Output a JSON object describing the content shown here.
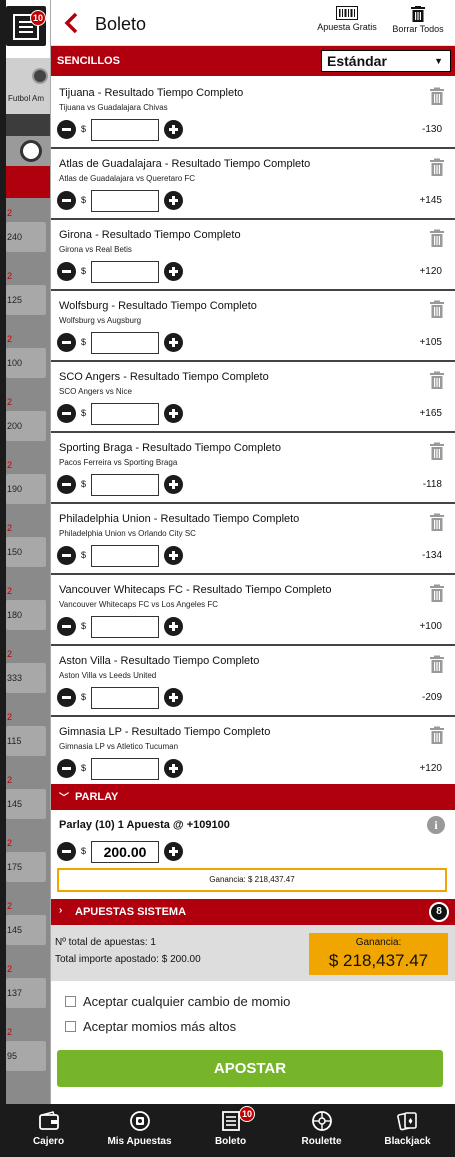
{
  "header": {
    "title": "Boleto",
    "gratis_label": "Apuesta Gratis",
    "borrar_label": "Borrar Todos",
    "ticket_count": "10"
  },
  "background": {
    "sport_label": "Futbol Am",
    "row_values": [
      "240",
      "125",
      "100",
      "200",
      "190",
      "150",
      "180",
      "333",
      "115",
      "145",
      "175",
      "145",
      "137",
      "95"
    ],
    "row_mark": "2"
  },
  "sencillos": {
    "label": "SENCILLOS",
    "selector_value": "Estándar"
  },
  "bets": [
    {
      "market": "Tijuana - Resultado Tiempo Completo",
      "event": "Tijuana vs Guadalajara Chivas",
      "odds": "-130"
    },
    {
      "market": "Atlas de Guadalajara - Resultado Tiempo Completo",
      "event": "Atlas de Guadalajara vs Queretaro FC",
      "odds": "+145"
    },
    {
      "market": "Girona - Resultado Tiempo Completo",
      "event": "Girona vs Real Betis",
      "odds": "+120"
    },
    {
      "market": "Wolfsburg - Resultado Tiempo Completo",
      "event": "Wolfsburg vs Augsburg",
      "odds": "+105"
    },
    {
      "market": "SCO Angers - Resultado Tiempo Completo",
      "event": "SCO Angers vs Nice",
      "odds": "+165"
    },
    {
      "market": "Sporting Braga - Resultado Tiempo Completo",
      "event": "Pacos Ferreira vs Sporting Braga",
      "odds": "-118"
    },
    {
      "market": "Philadelphia Union - Resultado Tiempo Completo",
      "event": "Philadelphia Union vs Orlando City SC",
      "odds": "-134"
    },
    {
      "market": "Vancouver Whitecaps FC - Resultado Tiempo Completo",
      "event": "Vancouver Whitecaps FC vs Los Angeles FC",
      "odds": "+100"
    },
    {
      "market": "Aston Villa - Resultado Tiempo Completo",
      "event": "Aston Villa vs Leeds United",
      "odds": "-209"
    },
    {
      "market": "Gimnasia LP - Resultado Tiempo Completo",
      "event": "Gimnasia LP vs Atletico Tucuman",
      "odds": "+120"
    }
  ],
  "currency_symbol": "$",
  "parlay": {
    "label": "PARLAY",
    "summary": "Parlay (10)   1 Apuesta @ +109100",
    "stake": "200.00",
    "ganancia": "Ganancia: $ 218,437.47"
  },
  "sistema": {
    "label": "APUESTAS SISTEMA",
    "count": "8"
  },
  "totals": {
    "total_apuestas": "Nº total de apuestas: 1",
    "total_importe": "Total importe apostado: $ 200.00",
    "ganancia_label": "Ganancia:",
    "ganancia_value": "$ 218,437.47"
  },
  "options": {
    "accept_changes": "Aceptar cualquier cambio de momio",
    "accept_higher": "Aceptar momios más altos"
  },
  "apostar_label": "APOSTAR",
  "nav": [
    {
      "label": "Cajero",
      "icon": "wallet-icon"
    },
    {
      "label": "Mis Apuestas",
      "icon": "my-bets-icon"
    },
    {
      "label": "Boleto",
      "icon": "ticket-icon",
      "badge": "10"
    },
    {
      "label": "Roulette",
      "icon": "roulette-icon"
    },
    {
      "label": "Blackjack",
      "icon": "cards-icon"
    }
  ],
  "colors": {
    "brand_red": "#b0000e",
    "accent_orange": "#f0a500",
    "apostar_green": "#76b52a",
    "dark": "#1b1b1b"
  }
}
